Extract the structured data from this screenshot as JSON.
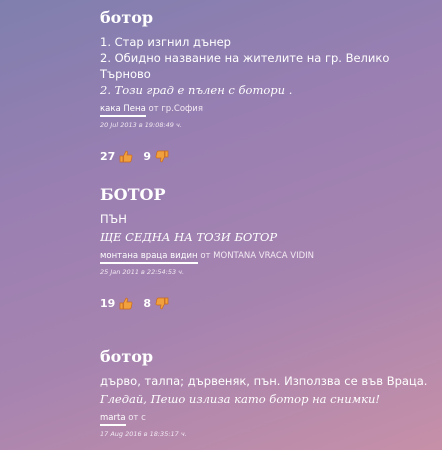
{
  "entries": [
    {
      "word": "ботор",
      "definitions": [
        "1. Стар изгнил дънер",
        "2. Обидно название на жителите на гр. Велико Търново"
      ],
      "example": "2. Този град е пълен с ботори .",
      "author": "кака Пена",
      "from_prefix": "от",
      "location": "гр.София",
      "date": "20 Jul 2013 в 19:08:49 ч.",
      "upvotes": "27",
      "downvotes": "9"
    },
    {
      "word": "БОТОР",
      "definitions": [
        "ПЪН"
      ],
      "example": "ЩЕ СЕДНА НА ТОЗИ БОТОР",
      "author": "монтана враца видин",
      "from_prefix": "от",
      "location": "MONTANA VRACA VIDIN",
      "date": "25 Jan 2011 в 22:54:53 ч.",
      "upvotes": "19",
      "downvotes": "8"
    },
    {
      "word": "ботор",
      "definitions": [
        "дърво, талпа; дървеняк, пън. Използва се във Враца."
      ],
      "example": "Гледай, Пешо излиза като ботор на снимки!",
      "author": "marta",
      "from_prefix": "от",
      "location": "с",
      "date": "17 Aug 2016 в 18:35:17 ч."
    }
  ],
  "colors": {
    "thumb_fill": "#f0a03c",
    "thumb_outline": "#c8691e"
  },
  "icons": {
    "up": "thumbs-up-icon",
    "down": "thumbs-down-icon"
  }
}
